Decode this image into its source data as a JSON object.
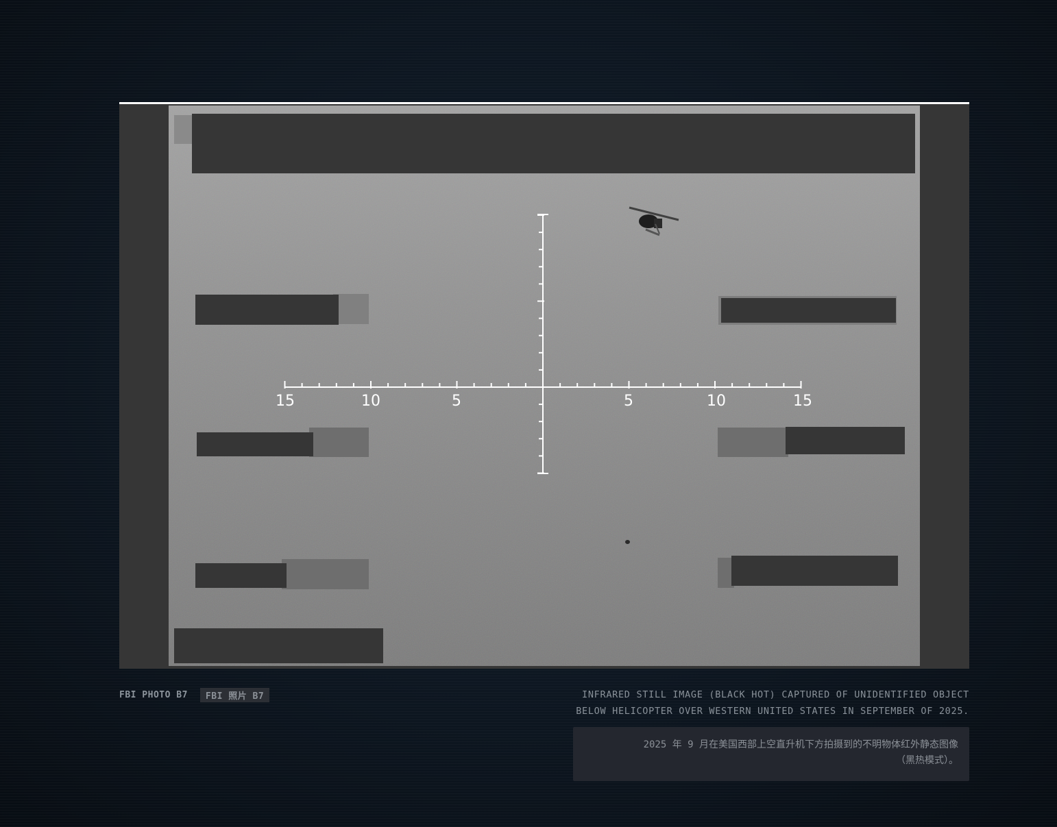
{
  "image": {
    "reticle": {
      "horizontal_labels": [
        "15",
        "10",
        "5",
        "5",
        "10",
        "15"
      ]
    },
    "target_icon": "helicopter-icon"
  },
  "caption": {
    "credit_en": "FBI PHOTO B7",
    "credit_zh": "FBI 照片 B7",
    "description_en_line1": "INFRARED STILL IMAGE (BLACK HOT) CAPTURED OF UNIDENTIFIED OBJECT",
    "description_en_line2": "BELOW HELICOPTER OVER WESTERN UNITED STATES IN SEPTEMBER OF 2025.",
    "description_zh_line1": "2025 年 9 月在美国西部上空直升机下方拍摄到的不明物体红外静态图像",
    "description_zh_line2": "（黑热模式）。"
  },
  "colors": {
    "redaction": "#363636",
    "frame_border": "#ffffff",
    "reticle": "#ffffff",
    "page_background": "#0c131c"
  }
}
